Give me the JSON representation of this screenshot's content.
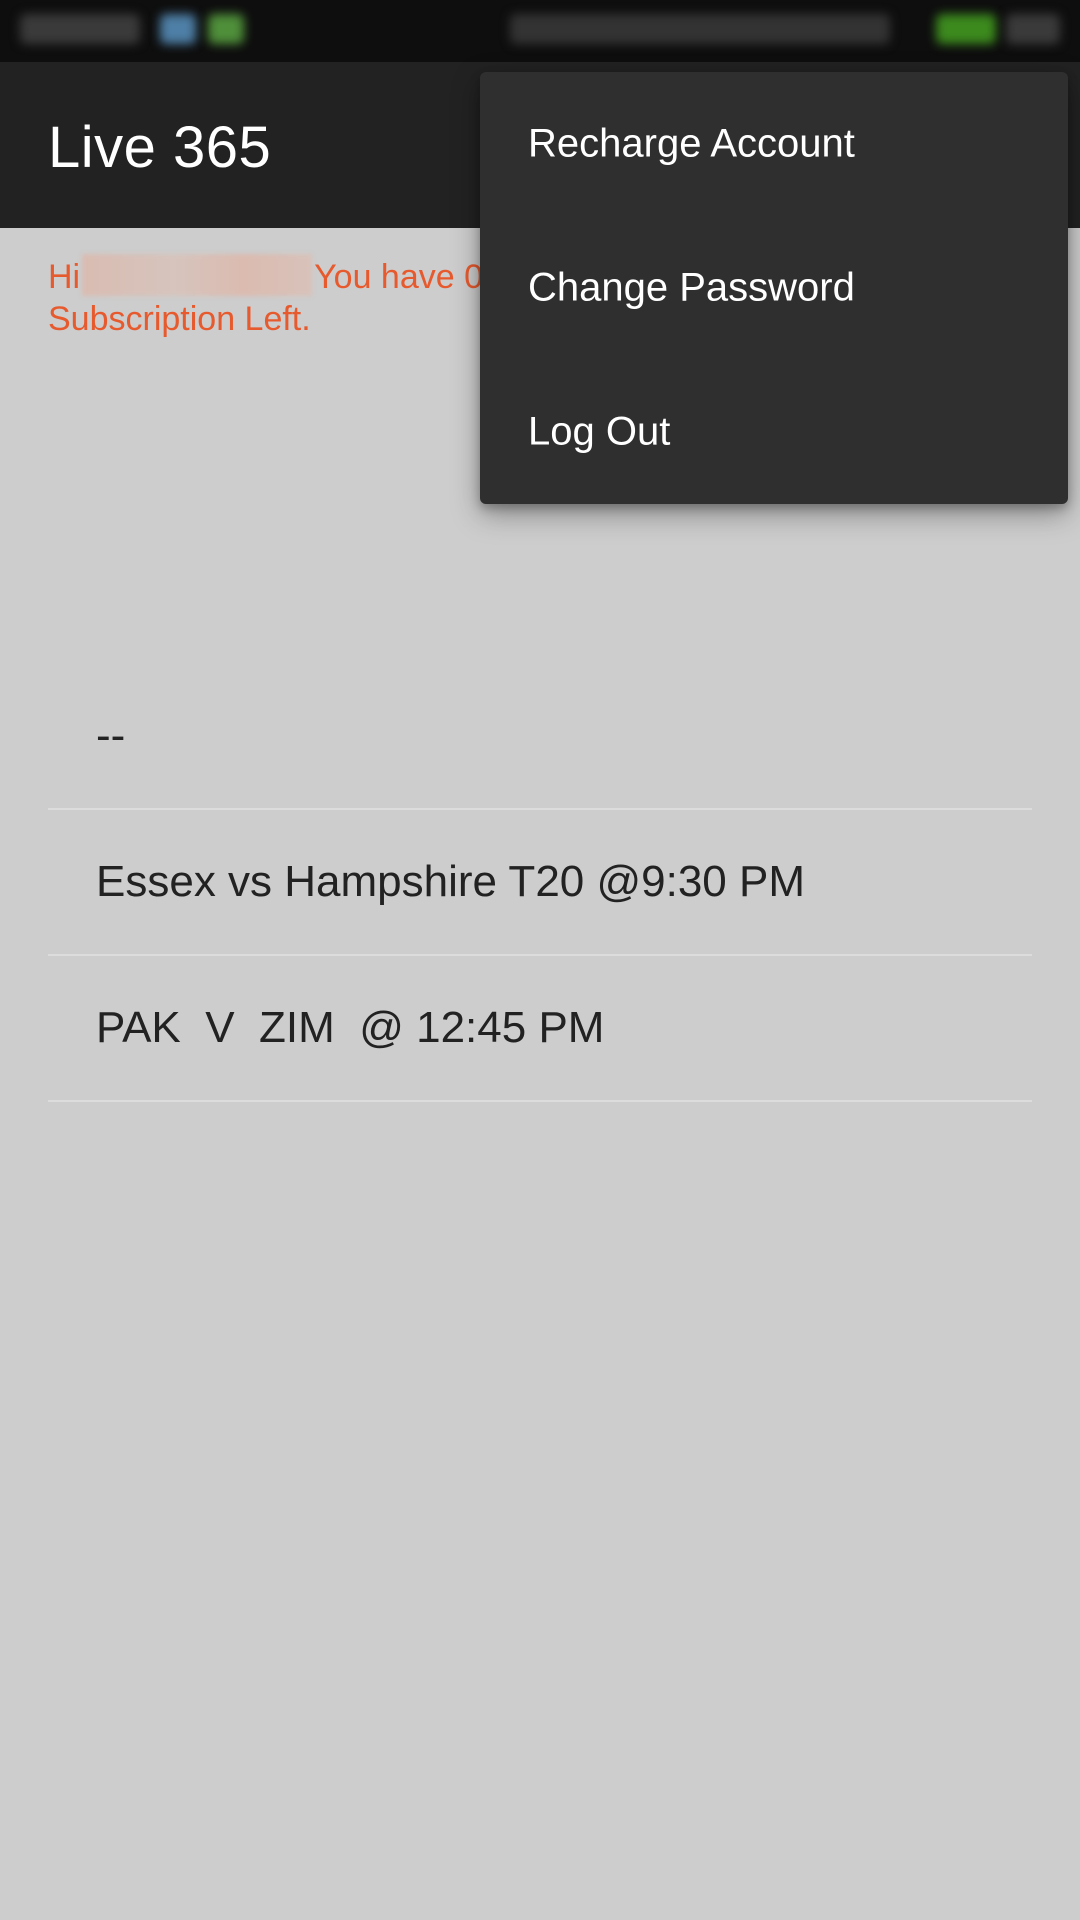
{
  "app_bar": {
    "title": "Live 365"
  },
  "greeting": {
    "prefix": "Hi",
    "visible_suffix": "You have 0",
    "line2": "Subscription Left."
  },
  "matches": [
    {
      "label": "--"
    },
    {
      "label": "Essex vs Hampshire T20 @9:30 PM"
    },
    {
      "label": "PAK  V  ZIM  @ 12:45 PM"
    }
  ],
  "overflow_menu": {
    "items": [
      {
        "label": "Recharge Account"
      },
      {
        "label": "Change Password"
      },
      {
        "label": "Log Out"
      }
    ]
  },
  "colors": {
    "app_bar": "#222222",
    "background": "#cdcdcd",
    "greeting_text": "#e65a2e",
    "menu_bg": "#2f2f2f"
  }
}
